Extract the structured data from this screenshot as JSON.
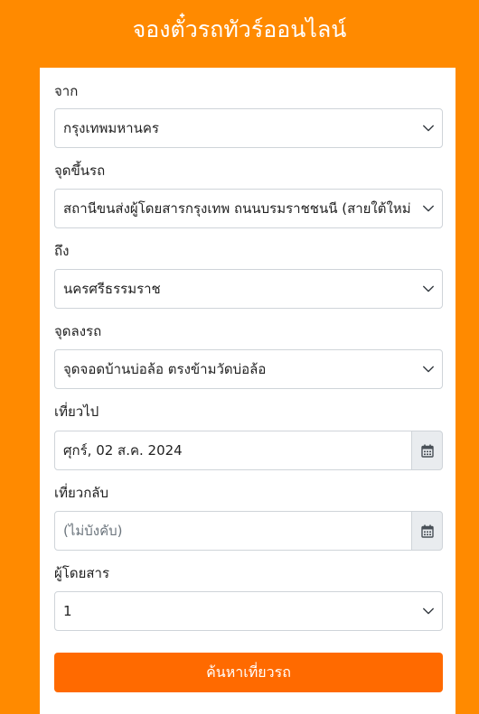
{
  "page": {
    "title": "จองตั๋วรถทัวร์ออนไลน์"
  },
  "form": {
    "from": {
      "label": "จาก",
      "value": "กรุงเทพมหานคร"
    },
    "boarding": {
      "label": "จุดขึ้นรถ",
      "value": "สถานีขนส่งผู้โดยสารกรุงเทพ ถนนบรมราชชนนี (สายใต้ใหม่)"
    },
    "to": {
      "label": "ถึง",
      "value": "นครศรีธรรมราช"
    },
    "dropoff": {
      "label": "จุดลงรถ",
      "value": "จุดจอดบ้านบ่อล้อ ตรงข้ามวัดบ่อล้อ"
    },
    "depart": {
      "label": "เที่ยวไป",
      "value": "ศุกร์, 02 ส.ค. 2024",
      "icon": "calendar-icon"
    },
    "return": {
      "label": "เที่ยวกลับ",
      "value": "",
      "placeholder": "(ไม่บังคับ)",
      "icon": "calendar-icon"
    },
    "passengers": {
      "label": "ผู้โดยสาร",
      "value": "1"
    },
    "submit_label": "ค้นหาเที่ยวรถ"
  },
  "colors": {
    "background": "#ff8a00",
    "button": "#ff6a00",
    "card": "#ffffff",
    "addon": "#e9ecef"
  }
}
